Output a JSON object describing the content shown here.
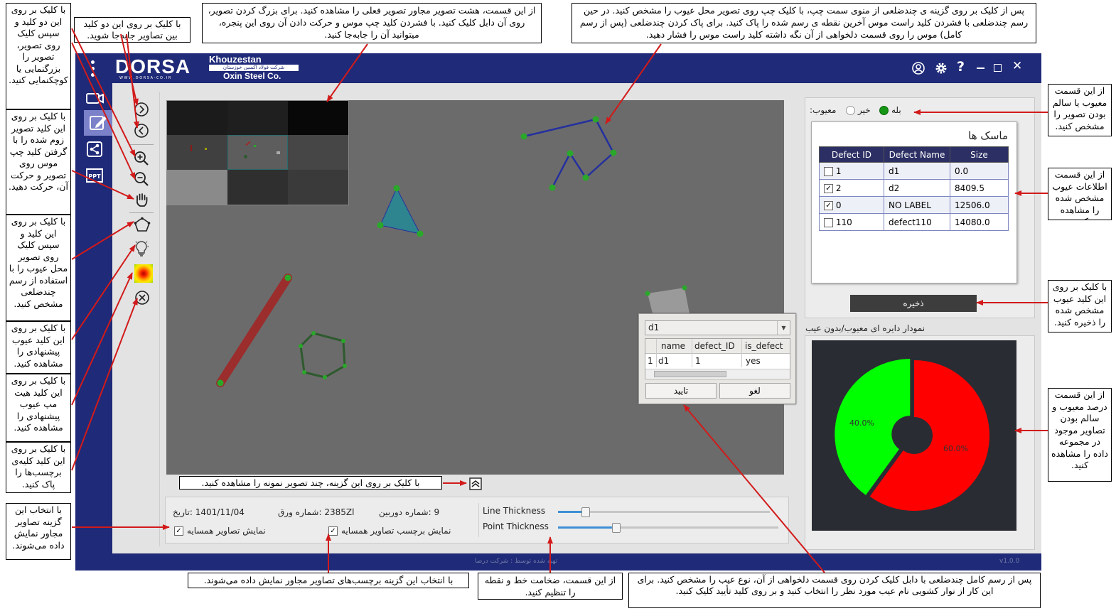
{
  "app": {
    "logo_text": "DORSA",
    "logo_sub": "W W W . D O R S A - C O . I R",
    "brand_top": "Khouzestan",
    "brand_mid": "شرکت فولاد اکسین خوزستان",
    "brand_bottom": "Oxin Steel Co.",
    "footer_credit": "تهیه شده توسط : شرکت درصا",
    "version": "v1.0.0"
  },
  "colors": {
    "app_bg": "#1f2a78",
    "canvas": "#6b6b6b",
    "defective": "#ff0000",
    "healthy": "#00ff00"
  },
  "titlebar_icons": [
    "user-icon",
    "gear-icon",
    "help-icon",
    "minimize-icon",
    "maximize-icon",
    "close-icon"
  ],
  "sidebar_icons": [
    "camera-icon",
    "edit-icon",
    "share-icon",
    "ppt-icon"
  ],
  "toolbar_icons": [
    "next-image-icon",
    "previous-image-icon",
    "zoom-in-icon",
    "zoom-out-icon",
    "hand-pan-icon",
    "polygon-icon",
    "bulb-icon",
    "heatmap-icon",
    "clear-icon"
  ],
  "defect_status": {
    "label": ":معیوب",
    "no": "خیر",
    "yes": "بله"
  },
  "masks": {
    "title": "ماسک ها",
    "headers": [
      "Defect ID",
      "Defect Name",
      "Size"
    ],
    "rows": [
      {
        "checked": false,
        "id": "1",
        "name": "d1",
        "size": "0.0"
      },
      {
        "checked": true,
        "id": "2",
        "name": "d2",
        "size": "8409.5"
      },
      {
        "checked": true,
        "id": "0",
        "name": "NO LABEL",
        "size": "12506.0"
      },
      {
        "checked": false,
        "id": "110",
        "name": "defect110",
        "size": "14080.0"
      }
    ]
  },
  "save_button": "ذخیره",
  "pie": {
    "title": "نمودار دایره ای معیوب/بدون عیب",
    "defective_label": "60.0%",
    "healthy_label": "40.0%"
  },
  "chart_data": {
    "type": "pie",
    "labels": [
      "معیوب",
      "بدون عیب"
    ],
    "values": [
      60.0,
      40.0
    ],
    "colors": [
      "#ff0000",
      "#00ff00"
    ],
    "title": "نمودار دایره ای معیوب/بدون عیب"
  },
  "dialog": {
    "selected": "d1",
    "headers": [
      "name",
      "defect_ID",
      "is_defect"
    ],
    "row": {
      "index": "1",
      "name": "d1",
      "defect_id": "1",
      "is_defect": "yes"
    },
    "confirm": "تایید",
    "cancel": "لغو"
  },
  "info": {
    "date": "1401/11/04 :تاریخ",
    "sheet": "2385Zl :شماره ورق",
    "camera": "9 :شماره دوربین",
    "show_neighbors": "نمایش تصاویر همسایه",
    "show_neighbor_labels": "نمایش برچسب تصاویر همسایه",
    "line_thickness": "Line Thickness",
    "point_thickness": "Point Thickness",
    "line_thickness_level": 0.26,
    "point_thickness_level": 0.54
  },
  "notes": {
    "n_neighbors": "از این قسمت، هشت تصویر مجاور تصویر فعلی را مشاهده کنید. برای بزرگ کردن تصویر، روی آن دابل کلیک کنید. با فشردن کلید چپ موس و حرکت دادن آن روی این پنجره، میتوانید آن را جابه‌جا کنید.",
    "n_polygon": "پس از کلیک بر روی گزینه ی چندضلعی از منوی سمت چپ، با کلیک چپ روی تصویر محل عیوب را مشخص کنید. در حین رسم چندضلعی با فشردن کلید راست موس آخرین نقطه ی رسم شده را پاک کنید. برای پاک کردن چندضلعی (پس از رسم کامل) موس را روی قسمت دلخواهی از آن نگه داشته کلید راست موس را فشار دهید.",
    "n_zoom": "با کلیک بر روی این دو کلید و سپس کلیک روی تصویر، تصویر را بزرگنمایی یا کوچکنمایی کنید.",
    "n_move": "با کلیک بر روی این دو کلید بین تصاویر جابه‌جا شوید.",
    "n_pan": "با کلیک بر روی این کلید تصویر زوم شده را با گرفتن کلید چپ موس روی تصویر و حرکت آن، حرکت دهید.",
    "n_draw": "با کلیک بر روی این کلید و سپس کلیک روی تصویر محل عیوب را با استفاده از رسم چندضلعی مشخص کنید.",
    "n_suggest": "با کلیک بر روی این کلید عیوب پیشنهادی را مشاهده کنید.",
    "n_heatmap": "با کلیک بر روی این کلید هیت مپ عیوب پیشنهادی را مشاهده کنید.",
    "n_clear": "با کلیک بر روی این کلید کلیه‌ی برچسب‌ها را پاک کنید.",
    "n_neighbors_check": "با انتخاب این گزینه تصاویر مجاور نمایش داده می‌شوند.",
    "n_status": "از این قسمت معیوب یا سالم بودن تصویر را مشخص کنید.",
    "n_info": "از این قسمت اطلاعات عیوب مشخص شده را مشاهده کنید.",
    "n_save": "با کلیک بر روی این کلید عیوب مشخص شده را ذخیره کنید.",
    "n_percent": "از این قسمت درصد معیوب و سالم بودن تصاویر موجود در مجموعه داده را مشاهده کنید.",
    "n_samples": "با کلیک بر روی این گزینه، چند تصویر نمونه را مشاهده کنید.",
    "n_labels_check": "با انتخاب این گزینه برچسب‌های تصاویر مجاور نمایش داده می‌شوند.",
    "n_thickness": "از این قسمت، ضخامت خط و نقطه را تنظیم کنید.",
    "n_dialog": "پس از رسم کامل چندضلعی با دابل کلیک کردن روی قسمت دلخواهی از آن، نوع عیب را مشخص کنید. برای این کار از نوار کشویی نام عیب مورد نظر را انتخاب کنید و بر روی کلید تأیید کلیک کنید."
  }
}
